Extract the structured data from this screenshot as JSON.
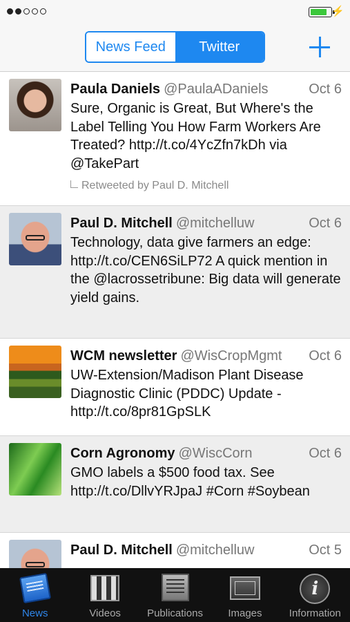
{
  "status": {
    "signal_bars": 2,
    "signal_total": 5,
    "battery_level": 0.85
  },
  "nav": {
    "segments": [
      {
        "label": "News Feed",
        "selected": false
      },
      {
        "label": "Twitter",
        "selected": true
      }
    ],
    "add_icon": "plus-icon"
  },
  "tweets": [
    {
      "name": "Paula Daniels",
      "handle": "@PaulaADaniels",
      "date": "Oct 6",
      "text": "Sure, Organic is Great, But Where's the Label Telling You How Farm Workers Are Treated? http://t.co/4YcZfn7kDh via @TakePart",
      "retweet": "Retweeted by Paul D. Mitchell"
    },
    {
      "name": "Paul D. Mitchell",
      "handle": "@mitchelluw",
      "date": "Oct 6",
      "text": "Technology, data give farmers an edge: http://t.co/CEN6SiLP72  A quick mention in the @lacrossetribune: Big data will generate yield gains."
    },
    {
      "name": "WCM newsletter",
      "handle": "@WisCropMgmt",
      "date": "Oct 6",
      "text": "UW-Extension/Madison Plant Disease Diagnostic Clinic (PDDC) Update - http://t.co/8pr81GpSLK"
    },
    {
      "name": "Corn Agronomy",
      "handle": "@WiscCorn",
      "date": "Oct 6",
      "text": "GMO labels a $500 food tax. See http://t.co/DllvYRJpaJ #Corn #Soybean"
    },
    {
      "name": "Paul D. Mitchell",
      "handle": "@mitchelluw",
      "date": "Oct 5",
      "text": ""
    }
  ],
  "tabs": [
    {
      "label": "News",
      "icon": "newspaper-icon",
      "active": true
    },
    {
      "label": "Videos",
      "icon": "clapperboard-icon",
      "active": false
    },
    {
      "label": "Publications",
      "icon": "publications-icon",
      "active": false
    },
    {
      "label": "Images",
      "icon": "images-icon",
      "active": false
    },
    {
      "label": "Information",
      "icon": "info-icon",
      "active": false
    }
  ]
}
